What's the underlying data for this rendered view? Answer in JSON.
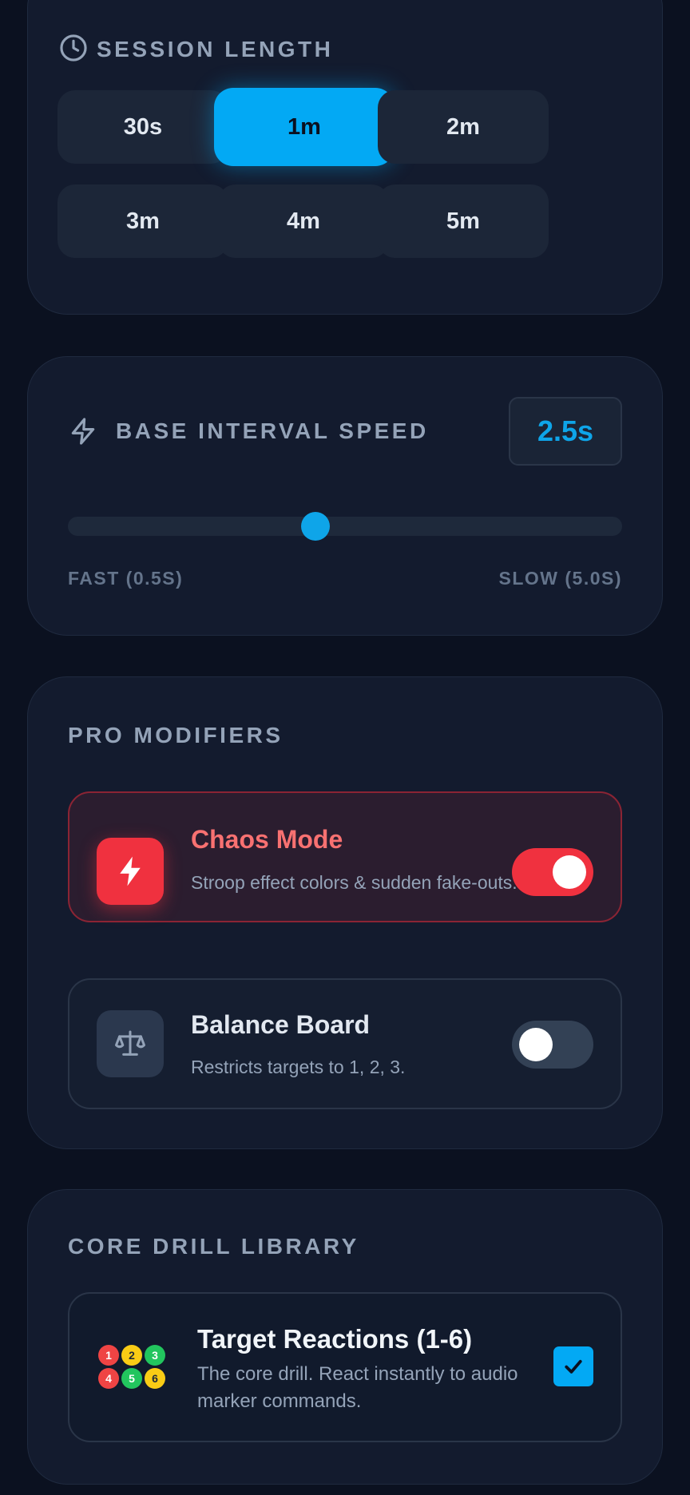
{
  "session": {
    "title": "SESSION LENGTH",
    "icon": "clock-icon",
    "options": [
      "30s",
      "1m",
      "2m",
      "3m",
      "4m",
      "5m"
    ],
    "selected": "1m"
  },
  "speed": {
    "title": "BASE INTERVAL SPEED",
    "icon": "lightning-icon",
    "value": "2.5s",
    "slider_fraction": 0.446,
    "min_label": "FAST (0.5S)",
    "max_label": "SLOW (5.0S)"
  },
  "pro": {
    "title": "PRO MODIFIERS",
    "chaos": {
      "title": "Chaos Mode",
      "description": "Stroop effect colors & sudden fake-outs.",
      "icon": "bolt-icon",
      "enabled": true
    },
    "balance": {
      "title": "Balance Board",
      "description": "Restricts targets to 1, 2, 3.",
      "icon": "scale-icon",
      "enabled": false
    }
  },
  "core": {
    "title": "CORE DRILL LIBRARY",
    "drill": {
      "title": "Target Reactions (1-6)",
      "description": "The core drill. React instantly to audio marker commands.",
      "numbers": [
        "1",
        "2",
        "3",
        "4",
        "5",
        "6"
      ],
      "checked": true
    }
  },
  "colors": {
    "accent": "#03a9f4",
    "danger": "#f0313f",
    "dot1": "#ef4444",
    "dot2": "#facc15",
    "dot3": "#22c55e",
    "dot4": "#ef4444",
    "dot5": "#22c55e",
    "dot6": "#facc15"
  }
}
